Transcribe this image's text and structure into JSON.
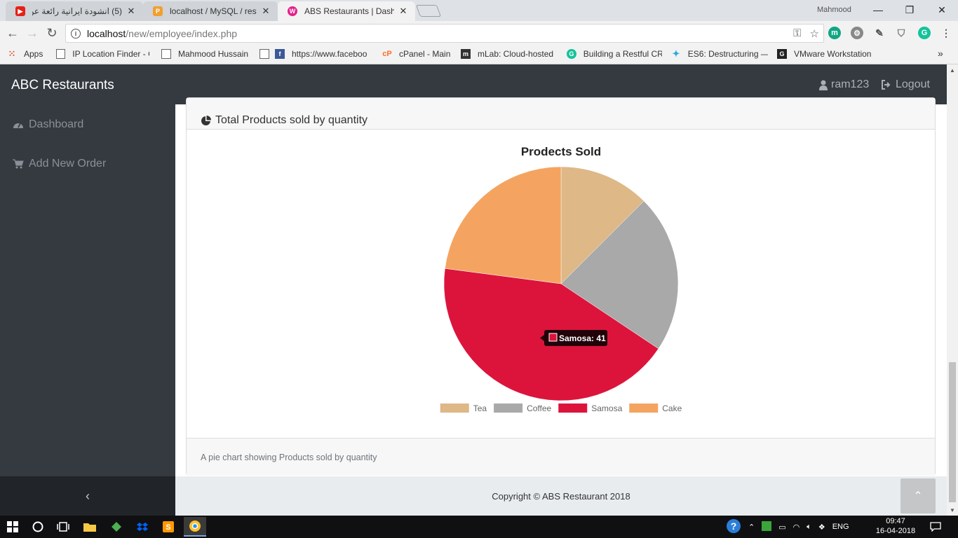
{
  "browser": {
    "tabs": [
      {
        "title": "(5) انشودة ايرانية رائعة عن",
        "icon": "youtube-icon"
      },
      {
        "title": "localhost / MySQL / resta",
        "icon": "phpmyadmin-icon"
      },
      {
        "title": "ABS Restaurants | Dashbo",
        "icon": "wamp-icon"
      }
    ],
    "profile": "Mahmood",
    "url_host": "localhost",
    "url_path": "/new/employee/index.php",
    "bookmarks": [
      {
        "label": "Apps",
        "icon": "apps-grid-icon"
      },
      {
        "label": "IP Location Finder - G",
        "icon": "page-icon"
      },
      {
        "label": "Mahmood Hussain",
        "icon": "page-icon"
      },
      {
        "label": "https://www.faceboo",
        "icon": "facebook-icon"
      },
      {
        "label": "cPanel - Main",
        "icon": "cpanel-icon"
      },
      {
        "label": "mLab: Cloud-hosted",
        "icon": "mlab-icon"
      },
      {
        "label": "Building a Restful CR",
        "icon": "grammarly-icon"
      },
      {
        "label": "ES6: Destructuring —",
        "icon": "es6-icon"
      },
      {
        "label": "VMware Workstation",
        "icon": "vmware-icon"
      }
    ]
  },
  "app": {
    "brand": "ABC Restaurants",
    "user": "ram123",
    "logout": "Logout",
    "sidebar": [
      {
        "label": "Dashboard",
        "icon": "dashboard-icon"
      },
      {
        "label": "Add New Order",
        "icon": "cart-icon"
      }
    ],
    "card_title": "Total Products sold by quantity",
    "card_footer": "A pie chart showing Products sold by quantity",
    "copyright": "Copyright © ABS Restaurant 2018",
    "tooltip": "Samosa: 41"
  },
  "chart_data": {
    "type": "pie",
    "title": "Prodects Sold",
    "categories": [
      "Tea",
      "Coffee",
      "Samosa",
      "Cake"
    ],
    "values": [
      12,
      21,
      41,
      22
    ],
    "colors": [
      "#deb887",
      "#a9a9a9",
      "#dc143c",
      "#f4a460"
    ],
    "legend": "bottom"
  },
  "taskbar": {
    "time": "09:47",
    "date": "16-04-2018",
    "lang": "ENG"
  }
}
